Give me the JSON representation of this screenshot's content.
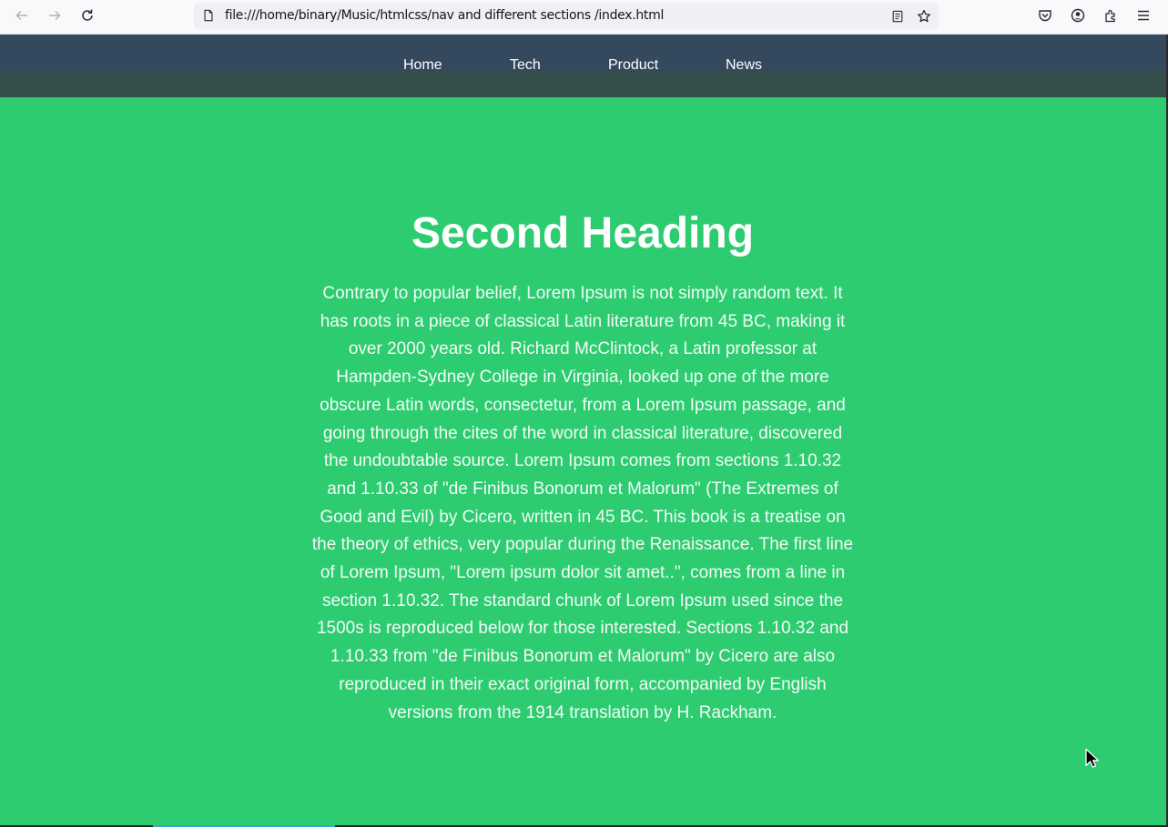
{
  "browser": {
    "url": "file:///home/binary/Music/htmlcss/nav and different sections /index.html"
  },
  "nav": {
    "links": [
      "Home",
      "Tech",
      "Product",
      "News"
    ]
  },
  "section": {
    "heading": "Second Heading",
    "paragraph": "Contrary to popular belief, Lorem Ipsum is not simply random text. It has roots in a piece of classical Latin literature from 45 BC, making it over 2000 years old. Richard McClintock, a Latin professor at Hampden-Sydney College in Virginia, looked up one of the more obscure Latin words, consectetur, from a Lorem Ipsum passage, and going through the cites of the word in classical literature, discovered the undoubtable source. Lorem Ipsum comes from sections 1.10.32 and 1.10.33 of \"de Finibus Bonorum et Malorum\" (The Extremes of Good and Evil) by Cicero, written in 45 BC. This book is a treatise on the theory of ethics, very popular during the Renaissance. The first line of Lorem Ipsum, \"Lorem ipsum dolor sit amet..\", comes from a line in section 1.10.32. The standard chunk of Lorem Ipsum used since the 1500s is reproduced below for those interested. Sections 1.10.32 and 1.10.33 from \"de Finibus Bonorum et Malorum\" by Cicero are also reproduced in their exact original form, accompanied by English versions from the 1914 translation by H. Rackham."
  },
  "colors": {
    "page_background": "#2ecc71",
    "nav_background": "#34495e",
    "text": "#ffffff"
  },
  "icons": [
    "back-arrow-icon",
    "forward-arrow-icon",
    "reload-icon",
    "page-icon",
    "reader-view-icon",
    "bookmark-star-icon",
    "pocket-icon",
    "account-icon",
    "extensions-icon",
    "menu-icon"
  ]
}
